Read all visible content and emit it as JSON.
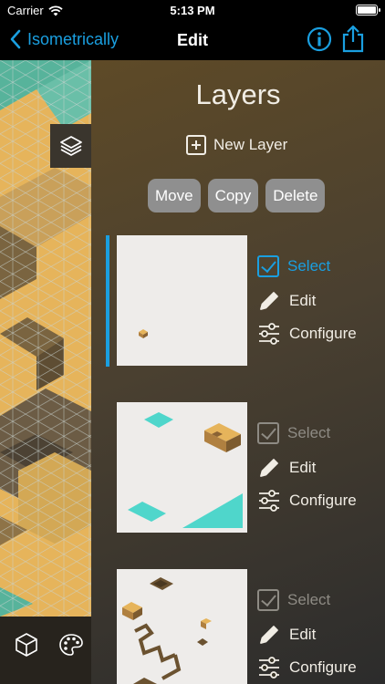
{
  "status_bar": {
    "carrier": "Carrier",
    "time": "5:13 PM"
  },
  "nav": {
    "back_label": "Isometrically",
    "title": "Edit"
  },
  "panel": {
    "title": "Layers",
    "new_layer_label": "New Layer",
    "buttons": {
      "move": "Move",
      "copy": "Copy",
      "delete": "Delete"
    }
  },
  "layers": [
    {
      "select": "Select",
      "edit": "Edit",
      "configure": "Configure",
      "selected": true
    },
    {
      "select": "Select",
      "edit": "Edit",
      "configure": "Configure",
      "selected": false
    },
    {
      "select": "Select",
      "edit": "Edit",
      "configure": "Configure",
      "selected": false
    }
  ],
  "colors": {
    "accent": "#1a9fe0",
    "teal": "#5fcfc4",
    "sand": "#e6b45b",
    "brown": "#6b5230"
  }
}
